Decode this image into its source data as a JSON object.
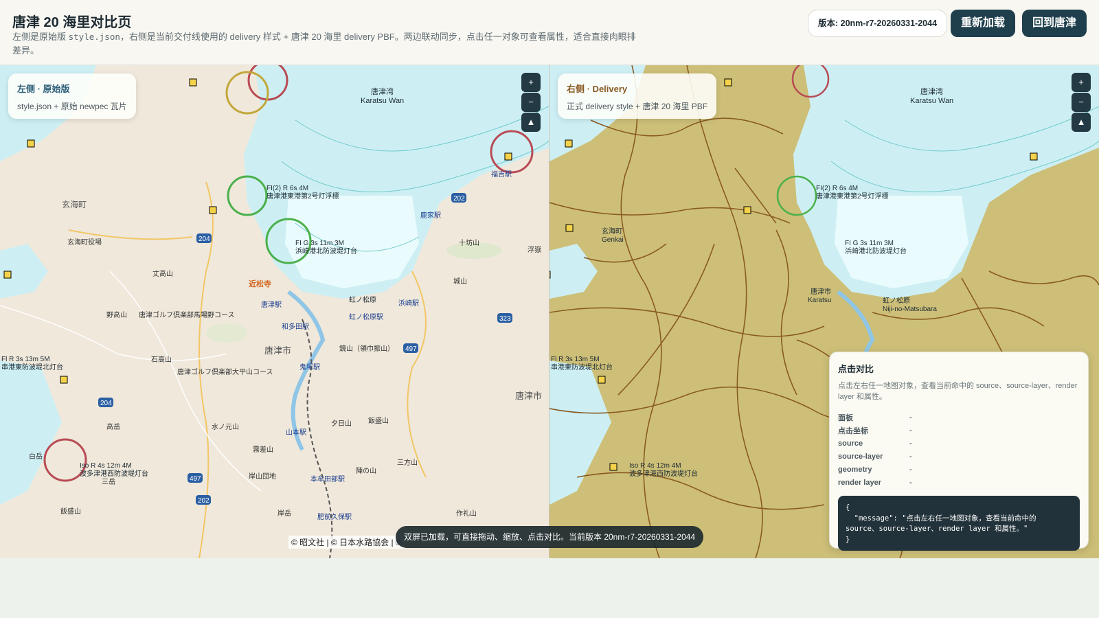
{
  "header": {
    "title": "唐津 20 海里对比页",
    "subtitle_prefix": "左侧是原始版 ",
    "subtitle_code": "style.json",
    "subtitle_suffix": "，右侧是当前交付线使用的 delivery 样式 + 唐津 20 海里 delivery PBF。两边联动同步，点击任一对象可查看属性，适合直接肉眼排差异。",
    "version_label": "版本: 20nm-r7-20260331-2044",
    "reload_label": "重新加载",
    "home_label": "回到唐津"
  },
  "left_panel": {
    "title": "左侧 · 原始版",
    "subtitle": "style.json + 原始 newpec 瓦片"
  },
  "right_panel": {
    "title": "右侧 · Delivery",
    "subtitle": "正式 delivery style + 唐津 20 海里 PBF"
  },
  "map_controls": {
    "zoom_in": "+",
    "zoom_out": "−",
    "compass": "▲"
  },
  "left_map_labels": {
    "bay_jp": "唐津湾",
    "bay_en": "Karatsu Wan",
    "genkai_town": "玄海町",
    "genkai_office": "玄海町役場",
    "karatsu_city": "唐津市",
    "karatsu_city_east": "唐津市",
    "kinshoji": "近松寺",
    "karatsu_st": "唐津駅",
    "wadayama_st": "和多田駅",
    "nijinomatsubara": "虹ノ松原",
    "nijinomatsubara_st": "虹ノ松原駅",
    "hamasaki_st": "浜崎駅",
    "fukuyoshi_st": "福吉駅",
    "shikaya_st": "鹿家駅",
    "jumonzan": "十坊山",
    "ukidake": "浮嶽",
    "joyama": "城山",
    "tanakayama": "丈高山",
    "nonomiyama": "野高山",
    "golf1": "唐津ゴルフ倶楽部馬場野コース",
    "golf2": "唐津ゴルフ倶楽部大平山コース",
    "ishitakayama": "石高山",
    "kagamiyama": "鏡山（領巾振山）",
    "onizuka_st": "鬼塚駅",
    "yamamoto_st": "山本駅",
    "yuhiyama": "夕日山",
    "iimoriyama": "飯盛山",
    "mizunomotoyama": "水ノ元山",
    "takao": "高岳",
    "kiriozan": "霧差山",
    "shiroiwa": "白岳",
    "mitsuishi": "三岳",
    "ganzanyama": "岸山団地",
    "honmuda_st": "本牟田部駅",
    "jinnoyama": "陣の山",
    "sangoyama": "三方山",
    "kishidake": "岸岳",
    "hizenkubo_st": "肥前久保駅",
    "sakuyama": "作礼山",
    "kinoshita": "飯盛山",
    "beacon1": "Iso R 4s 12m 4M",
    "beacon1_jp": "波多津港西防波堤灯台",
    "beacon2": "Fl R 3s 13m 5M",
    "beacon2_jp": "串港東防波堤北灯台",
    "beacon3": "FI(2) R 6s 4M",
    "beacon3_jp": "唐津港東港第2号灯浮標",
    "beacon4": "FI G 3s 11m 3M",
    "beacon4_jp": "浜崎港北防波堤灯台",
    "road_202": "202",
    "road_204": "204",
    "road_204b": "204",
    "road_323": "323",
    "road_497": "497",
    "road_497b": "497",
    "road_202b": "202"
  },
  "right_map_labels": {
    "bay_jp": "唐津湾",
    "bay_en": "Karatsu Wan",
    "genkai_jp": "玄海町",
    "genkai_en": "Genkai",
    "karatsu_jp": "唐津市",
    "karatsu_en": "Karatsu",
    "niji_jp": "虹ノ松原",
    "niji_en": "Niji-no-Matsubara",
    "beacon1": "Iso R 4s 12m 4M",
    "beacon1_jp": "波多津港西防波堤灯台",
    "beacon2": "Fl R 3s 13m 5M",
    "beacon2_jp": "串港東防波堤北灯台",
    "beacon3": "FI(2) R 6s 4M",
    "beacon3_jp": "唐津港東港第2号灯浮標",
    "beacon4": "FI G 3s 11m 3M",
    "beacon4_jp": "浜崎港北防波堤灯台"
  },
  "attribution": "© 昭文社 | © 日本水路協会 | ©",
  "toast": "双屏已加载，可直接拖动、缩放、点击对比。当前版本 20nm-r7-20260331-2044",
  "inspect_panel": {
    "title": "点击对比",
    "description": "点击左右任一地图对象，查看当前命中的 source、source-layer、render layer 和属性。",
    "rows": [
      {
        "key": "面板",
        "value": "-"
      },
      {
        "key": "点击坐标",
        "value": "-"
      },
      {
        "key": "source",
        "value": "-"
      },
      {
        "key": "source-layer",
        "value": "-"
      },
      {
        "key": "geometry",
        "value": "-"
      },
      {
        "key": "render layer",
        "value": "-"
      }
    ],
    "json_preview": "{\n  \"message\": \"点击左右任一地图对象，查看当前命中的 source、source-layer、render layer 和属性。\"\n}"
  },
  "colors": {
    "sea": "#cdeff4",
    "sea_shallow": "#a9e3ee",
    "land_left": "#efe8db",
    "land_right": "#cdbf78",
    "road_right": "#8a5a22",
    "accent": "#1f3f4c"
  }
}
